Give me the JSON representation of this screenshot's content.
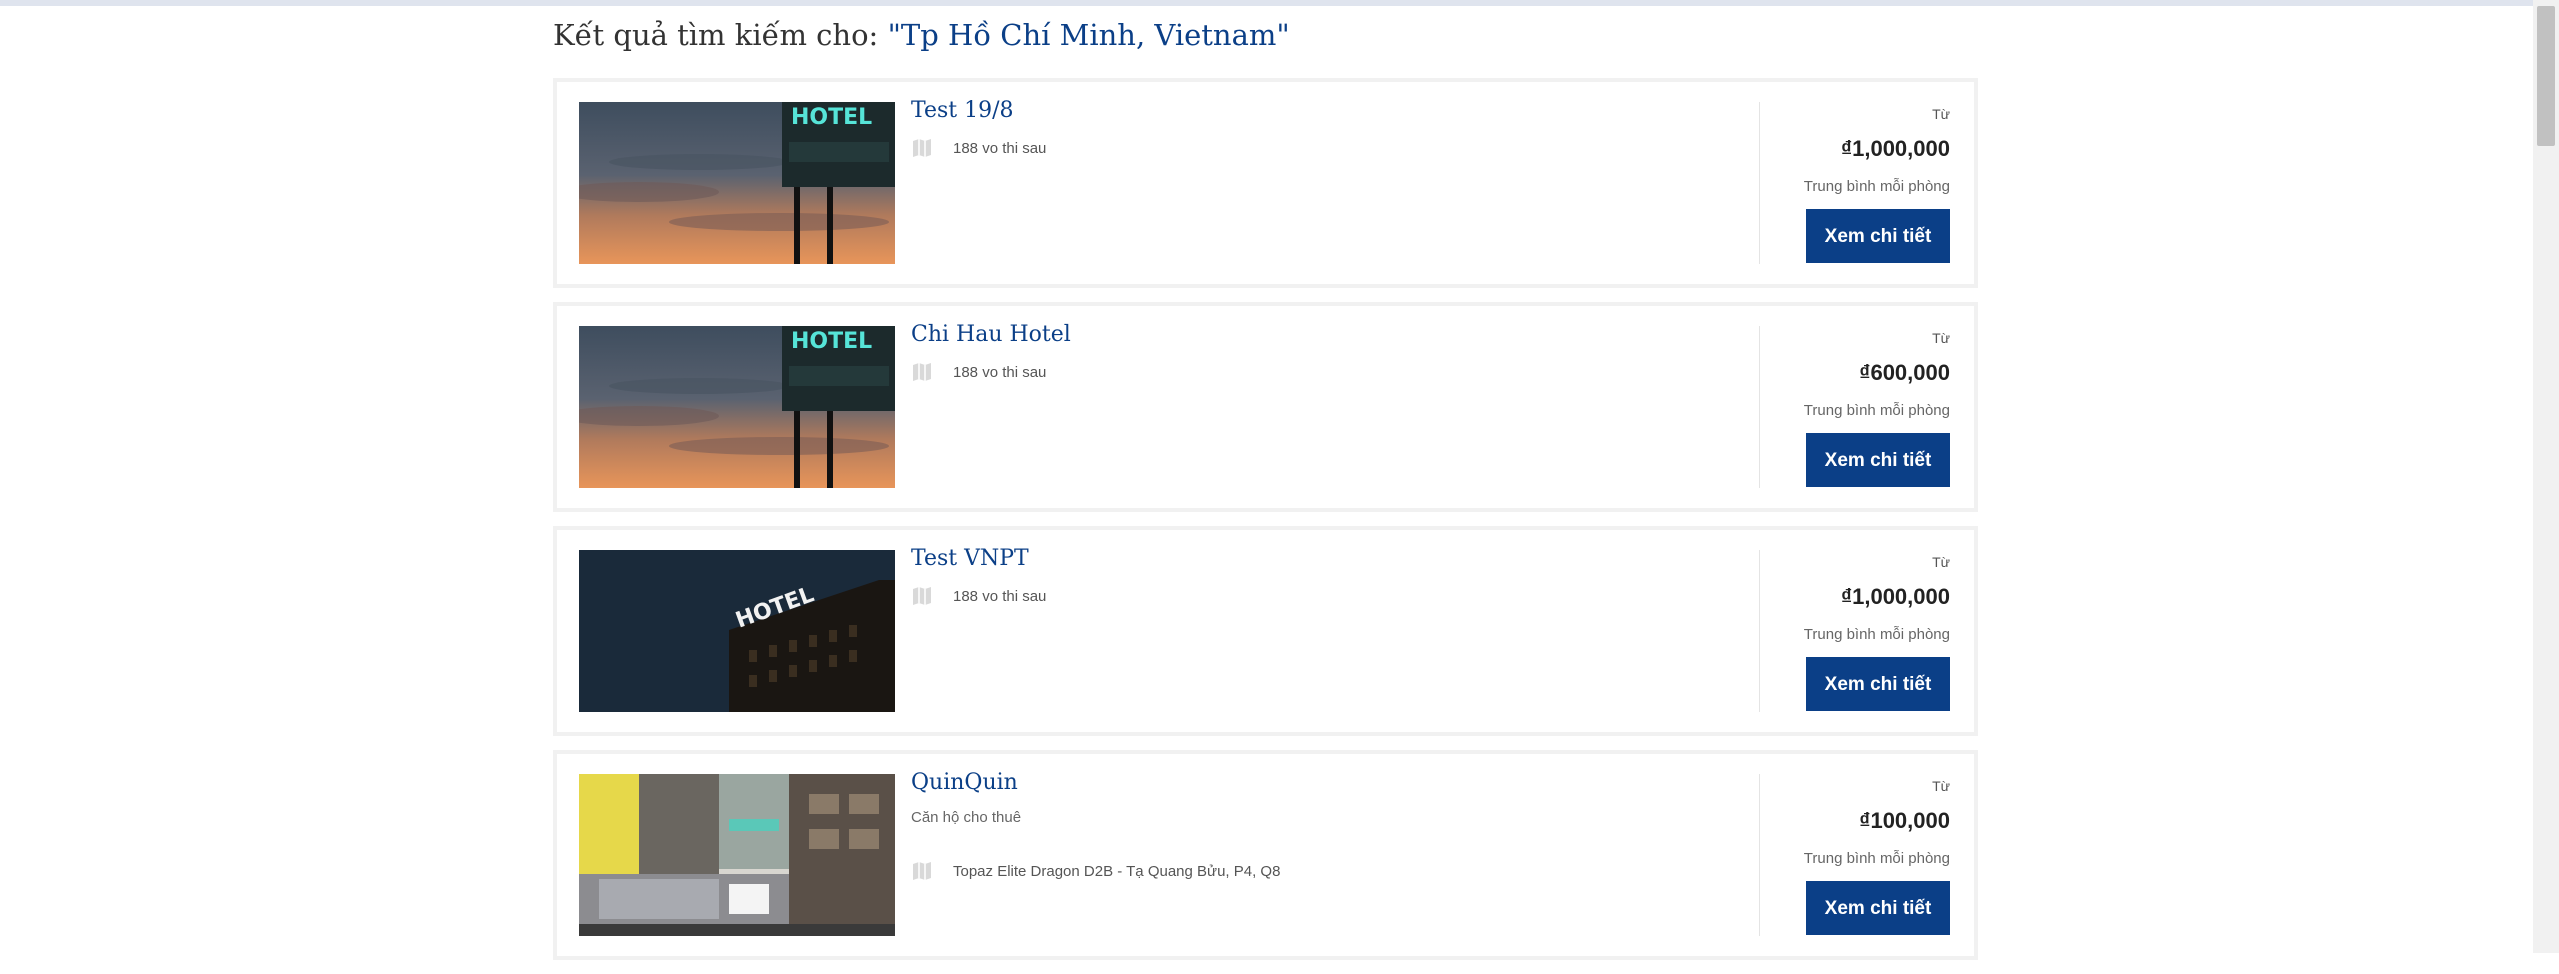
{
  "search": {
    "prefix": "Kết quả tìm kiếm cho:",
    "query": "\"Tp Hồ Chí Minh, Vietnam\""
  },
  "results": [
    {
      "name": "Test 19/8",
      "subtitle": "",
      "address": "188 vo thi sau",
      "from_label": "Từ",
      "price": "₫1,000,000",
      "avg_label": "Trung bình mỗi phòng",
      "button_label": "Xem chi tiết",
      "image": "hotel-sign-sunset"
    },
    {
      "name": "Chi Hau Hotel",
      "subtitle": "",
      "address": "188 vo thi sau",
      "from_label": "Từ",
      "price": "₫600,000",
      "avg_label": "Trung bình mỗi phòng",
      "button_label": "Xem chi tiết",
      "image": "hotel-sign-sunset"
    },
    {
      "name": "Test VNPT",
      "subtitle": "",
      "address": "188 vo thi sau",
      "from_label": "Từ",
      "price": "₫1,000,000",
      "avg_label": "Trung bình mỗi phòng",
      "button_label": "Xem chi tiết",
      "image": "hotel-building-night"
    },
    {
      "name": "QuinQuin",
      "subtitle": "Căn hộ cho thuê",
      "address": "Topaz Elite Dragon D2B - Tạ Quang Bửu, P4, Q8",
      "from_label": "Từ",
      "price": "₫100,000",
      "avg_label": "Trung bình mỗi phòng",
      "button_label": "Xem chi tiết",
      "image": "apartment-interior"
    }
  ],
  "colors": {
    "brand": "#0b3f87",
    "card_border": "#f1f1f1"
  }
}
